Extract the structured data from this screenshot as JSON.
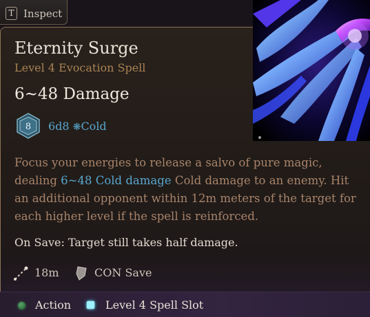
{
  "inspect": {
    "key": "T",
    "label": "Inspect"
  },
  "spell": {
    "name": "Eternity Surge",
    "level_school": "Level 4 Evocation Spell",
    "damage": "6~48 Damage",
    "die_face": "8",
    "dice": "6d8",
    "damage_type": "Cold",
    "description_before": "Focus your energies to release a salvo of pure magic, dealing ",
    "description_highlight": "6~48 Cold damage",
    "description_after": " Cold damage to an enemy. Hit an additional opponent within 12m meters of the target for each higher level if the spell is reinforced.",
    "on_save": "On Save: Target still takes half damage.",
    "range": "18m",
    "save_type": "CON Save"
  },
  "cost": {
    "action": "Action",
    "slot": "Level 4 Spell Slot"
  },
  "icons": {
    "key": "keyboard-key-icon",
    "die": "d8-die-icon",
    "cold": "snowflake-icon",
    "range": "range-icon",
    "save": "shield-icon",
    "action": "action-dot-icon",
    "slot": "spell-slot-icon"
  },
  "colors": {
    "accent_blue": "#58a7cf",
    "description": "#a8846a",
    "subtitle": "#a78255",
    "action_green": "#3d8a4c",
    "slot_cyan": "#9ef1ff"
  }
}
